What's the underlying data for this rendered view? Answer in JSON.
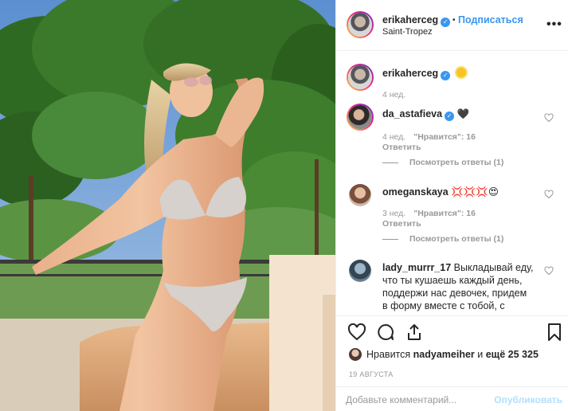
{
  "header": {
    "username": "erikaherceg",
    "verified_mark": "✓",
    "separator": "•",
    "follow_label": "Подписаться",
    "location": "Saint-Tropez",
    "more_label": "•••"
  },
  "caption": {
    "username": "erikaherceg",
    "emoji": "sun-emoji",
    "time": "4 нед."
  },
  "comments": [
    {
      "username": "da_astafieva",
      "verified_mark": "✓",
      "text": "🖤",
      "time": "4 нед.",
      "likes": "\"Нравится\": 16",
      "reply_label": "Ответить",
      "thread_label": "Посмотреть ответы (1)"
    },
    {
      "username": "omeganskaya",
      "text": "💢💢💢😍",
      "time": "3 нед.",
      "likes": "\"Нравится\": 16",
      "reply_label": "Ответить",
      "thread_label": "Посмотреть ответы (1)"
    },
    {
      "username": "lady_murrr_17",
      "text_line1": "Выкладывай еду,",
      "text_line2": "что ты кушаешь каждый день,",
      "text_line3": "поддержи нас девочек, придем",
      "text_line4": "в форму вместе с тобой, с"
    }
  ],
  "actions": {
    "liked_prefix": "Нравится",
    "liked_user": "nadyameiher",
    "liked_and": "и",
    "liked_others": "ещё 25 325",
    "date": "19 АВГУСТА"
  },
  "add_comment": {
    "placeholder": "Добавьте комментарий...",
    "publish_label": "Опубликовать"
  },
  "colors": {
    "accent": "#3897f0",
    "muted": "#999999",
    "publish_disabled": "#b2dffc"
  }
}
